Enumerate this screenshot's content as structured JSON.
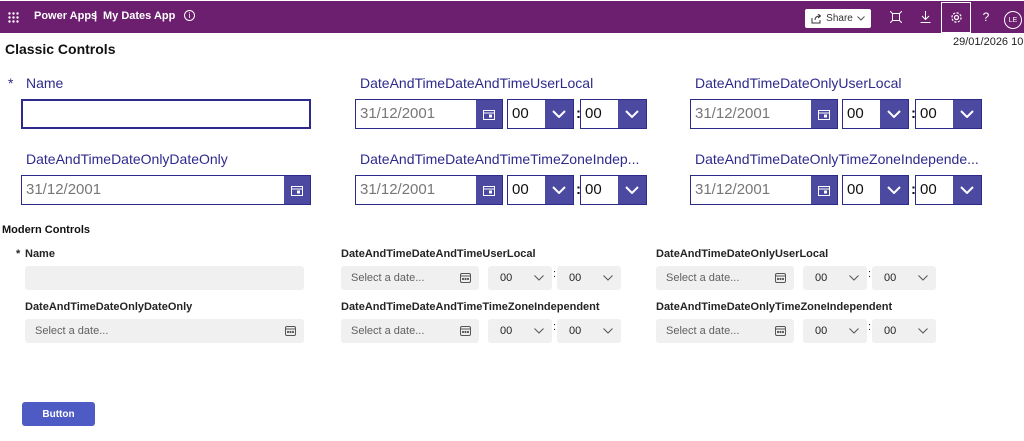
{
  "topbar": {
    "app_name": "Power Apps",
    "separator": "|",
    "app_title": "My Dates App",
    "share_label": "Share",
    "help_label": "?",
    "avatar_initials": "LE",
    "timestamp": "29/01/2026 10"
  },
  "classic": {
    "heading": "Classic Controls",
    "required_marker": "*",
    "name_label": "Name",
    "name_value": "",
    "fields": [
      {
        "label": "DateAndTimeDateAndTimeUserLocal",
        "date": "31/12/2001",
        "hour": "00",
        "minute": "00"
      },
      {
        "label": "DateAndTimeDateOnlyUserLocal",
        "date": "31/12/2001",
        "hour": "00",
        "minute": "00"
      },
      {
        "label": "DateAndTimeDateOnlyDateOnly",
        "date": "31/12/2001"
      },
      {
        "label": "DateAndTimeDateAndTimeTimeZoneIndep...",
        "date": "31/12/2001",
        "hour": "00",
        "minute": "00"
      },
      {
        "label": "DateAndTimeDateOnlyTimeZoneIndepende...",
        "date": "31/12/2001",
        "hour": "00",
        "minute": "00"
      }
    ],
    "time_separator": ":"
  },
  "modern": {
    "heading": "Modern Controls",
    "required_marker": "*",
    "name_label": "Name",
    "date_placeholder": "Select a date...",
    "labels": {
      "dt_user_local": "DateAndTimeDateAndTimeUserLocal",
      "do_user_local": "DateAndTimeDateOnlyUserLocal",
      "do_date_only": "DateAndTimeDateOnlyDateOnly",
      "dt_tz_indep": "DateAndTimeDateAndTimeTimeZoneIndependent",
      "do_tz_indep": "DateAndTimeDateOnlyTimeZoneIndependent"
    },
    "hour": "00",
    "minute": "00",
    "time_separator": ":"
  },
  "button_label": "Button",
  "colors": {
    "topbar": "#6b1f6e",
    "classic_accent": "#2e2a8c",
    "classic_button": "#4b4aa0",
    "modern_button": "#4f5bc4"
  }
}
